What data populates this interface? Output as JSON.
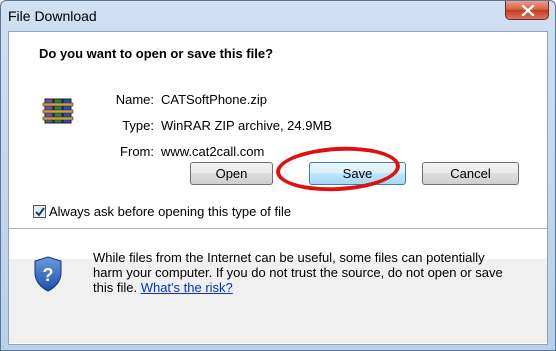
{
  "window": {
    "title": "File Download"
  },
  "dialog": {
    "question": "Do you want to open or save this file?",
    "file": {
      "icon": "winrar-archive-icon",
      "name_label": "Name:",
      "name_value": "CATSoftPhone.zip",
      "type_label": "Type:",
      "type_value": "WinRAR ZIP archive, 24.9MB",
      "from_label": "From:",
      "from_value": "www.cat2call.com"
    },
    "buttons": {
      "open": "Open",
      "save": "Save",
      "cancel": "Cancel"
    },
    "checkbox": {
      "label": "Always ask before opening this type of file",
      "checked": true
    },
    "warning": {
      "icon": "shield-question-icon",
      "text": "While files from the Internet can be useful, some files can potentially harm your computer. If you do not trust the source, do not open or save this file.",
      "link": "What's the risk?"
    }
  },
  "colors": {
    "highlight_ring": "#e01010",
    "link": "#0033cc"
  }
}
